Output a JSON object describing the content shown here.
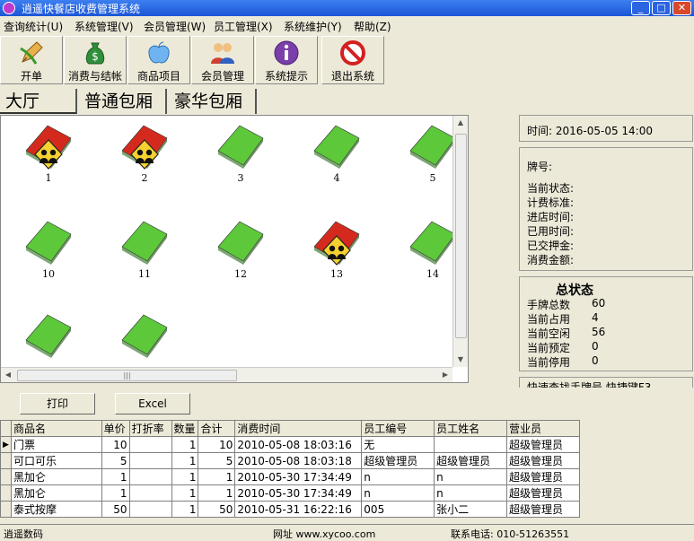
{
  "window": {
    "title": "逍遥快餐店收费管理系统"
  },
  "menu": [
    "查询统计(U)",
    "系统管理(V)",
    "会员管理(W)",
    "员工管理(X)",
    "系统维护(Y)",
    "帮助(Z)"
  ],
  "toolbar": [
    {
      "label": "开单",
      "icon": "pencil-icon"
    },
    {
      "label": "消费与结帐",
      "icon": "money-bag-icon"
    },
    {
      "label": "商品项目",
      "icon": "apple-icon"
    },
    {
      "label": "会员管理",
      "icon": "users-icon"
    },
    {
      "label": "系统提示",
      "icon": "info-icon"
    },
    {
      "label": "退出系统",
      "icon": "exit-icon"
    }
  ],
  "tabs": [
    "大厅",
    "普通包厢",
    "豪华包厢"
  ],
  "rooms": [
    {
      "num": "1",
      "status": "occupied"
    },
    {
      "num": "2",
      "status": "occupied"
    },
    {
      "num": "3",
      "status": "free"
    },
    {
      "num": "4",
      "status": "free"
    },
    {
      "num": "5",
      "status": "free"
    },
    {
      "num": "10",
      "status": "free"
    },
    {
      "num": "11",
      "status": "free"
    },
    {
      "num": "12",
      "status": "free"
    },
    {
      "num": "13",
      "status": "occupied"
    },
    {
      "num": "14",
      "status": "free"
    },
    {
      "num": "",
      "status": "free"
    },
    {
      "num": "",
      "status": "free"
    }
  ],
  "info": {
    "time": "时间: 2016-05-05 14:00",
    "plate_label": "牌号:",
    "fields": [
      "当前状态:",
      "计费标准:",
      "进店时间:",
      "已用时间:",
      "已交押金:",
      "消费金额:"
    ]
  },
  "stats": {
    "title": "总状态",
    "rows": [
      {
        "label": "手牌总数",
        "value": "60"
      },
      {
        "label": "当前占用",
        "value": "4"
      },
      {
        "label": "当前空闲",
        "value": "56"
      },
      {
        "label": "当前预定",
        "value": "0"
      },
      {
        "label": "当前停用",
        "value": "0"
      }
    ]
  },
  "quickfind": "快速查找手牌号  快捷键F3",
  "buttons": {
    "print": "打印",
    "excel": "Excel"
  },
  "table": {
    "headers": [
      "商品名",
      "单价",
      "打折率",
      "数量",
      "合计",
      "消费时间",
      "员工编号",
      "员工姓名",
      "营业员"
    ],
    "rows": [
      [
        "门票",
        "10",
        "",
        "1",
        "10",
        "2010-05-08 18:03:16",
        "无",
        "",
        "超级管理员"
      ],
      [
        "可口可乐",
        "5",
        "",
        "1",
        "5",
        "2010-05-08 18:03:18",
        "超级管理员",
        "超级管理员",
        "超级管理员"
      ],
      [
        "黑加仑",
        "1",
        "",
        "1",
        "1",
        "2010-05-30 17:34:49",
        "n",
        "n",
        "超级管理员"
      ],
      [
        "黑加仑",
        "1",
        "",
        "1",
        "1",
        "2010-05-30 17:34:49",
        "n",
        "n",
        "超级管理员"
      ],
      [
        "泰式按摩",
        "50",
        "",
        "1",
        "50",
        "2010-05-31 16:22:16",
        "005",
        "张小二",
        "超级管理员"
      ]
    ]
  },
  "status": {
    "left": "逍遥数码",
    "site": "网址 www.xycoo.com",
    "phone": "联系电话: 010-51263551"
  },
  "colors": {
    "free": "#5cc83a",
    "occupied": "#d42a1e",
    "titlebar": "#1b56d6"
  }
}
